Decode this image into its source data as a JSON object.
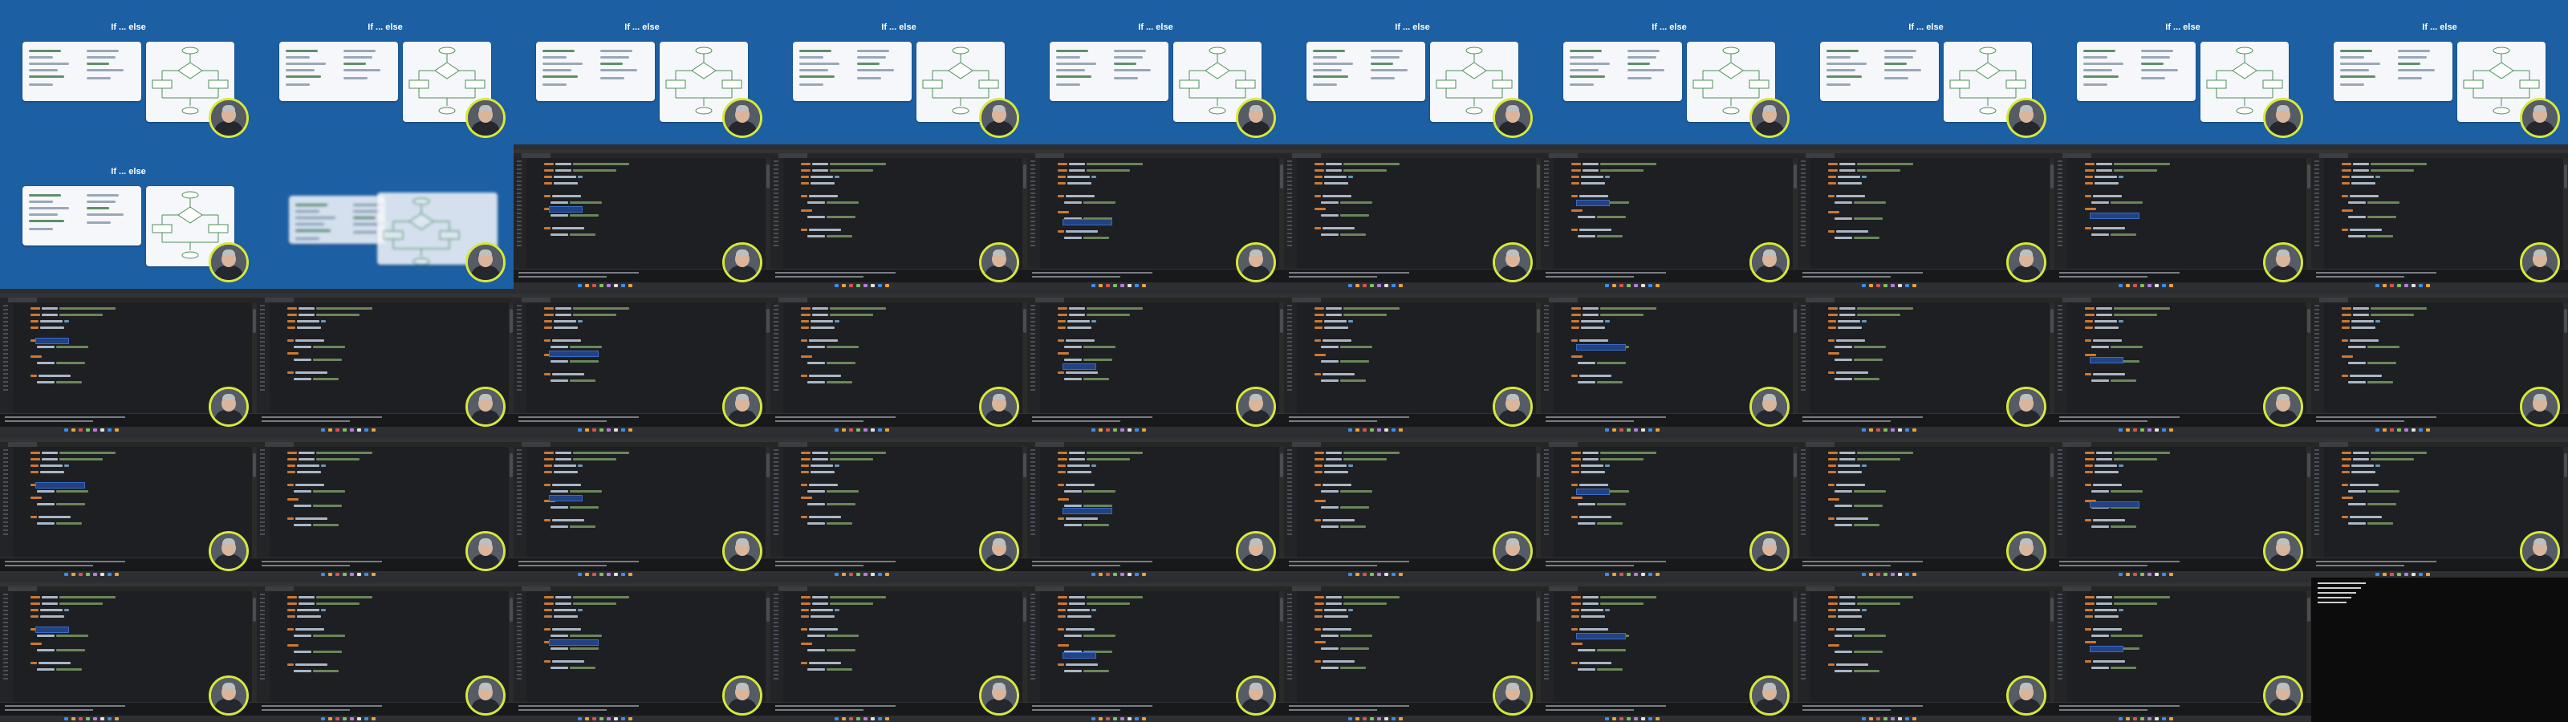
{
  "slides": {
    "title": "If ... else"
  },
  "tiles": [
    {
      "kind": "slide"
    },
    {
      "kind": "slide"
    },
    {
      "kind": "slide"
    },
    {
      "kind": "slide"
    },
    {
      "kind": "slide"
    },
    {
      "kind": "slide"
    },
    {
      "kind": "slide"
    },
    {
      "kind": "slide"
    },
    {
      "kind": "slide"
    },
    {
      "kind": "slide"
    },
    {
      "kind": "slide"
    },
    {
      "kind": "slide-transition"
    },
    {
      "kind": "ide"
    },
    {
      "kind": "ide"
    },
    {
      "kind": "ide"
    },
    {
      "kind": "ide"
    },
    {
      "kind": "ide"
    },
    {
      "kind": "ide"
    },
    {
      "kind": "ide"
    },
    {
      "kind": "ide"
    },
    {
      "kind": "ide"
    },
    {
      "kind": "ide"
    },
    {
      "kind": "ide"
    },
    {
      "kind": "ide"
    },
    {
      "kind": "ide"
    },
    {
      "kind": "ide"
    },
    {
      "kind": "ide"
    },
    {
      "kind": "ide"
    },
    {
      "kind": "ide"
    },
    {
      "kind": "ide"
    },
    {
      "kind": "ide"
    },
    {
      "kind": "ide"
    },
    {
      "kind": "ide"
    },
    {
      "kind": "ide"
    },
    {
      "kind": "ide"
    },
    {
      "kind": "ide"
    },
    {
      "kind": "ide"
    },
    {
      "kind": "ide"
    },
    {
      "kind": "ide"
    },
    {
      "kind": "ide"
    },
    {
      "kind": "ide"
    },
    {
      "kind": "ide"
    },
    {
      "kind": "ide"
    },
    {
      "kind": "ide"
    },
    {
      "kind": "ide"
    },
    {
      "kind": "ide"
    },
    {
      "kind": "ide"
    },
    {
      "kind": "ide"
    },
    {
      "kind": "ide"
    },
    {
      "kind": "console"
    }
  ],
  "colors": {
    "slide_background": "#1c5fa3",
    "ide_background": "#1e1f22",
    "webcam_ring": "#d7e83a",
    "selection": "#214283"
  }
}
